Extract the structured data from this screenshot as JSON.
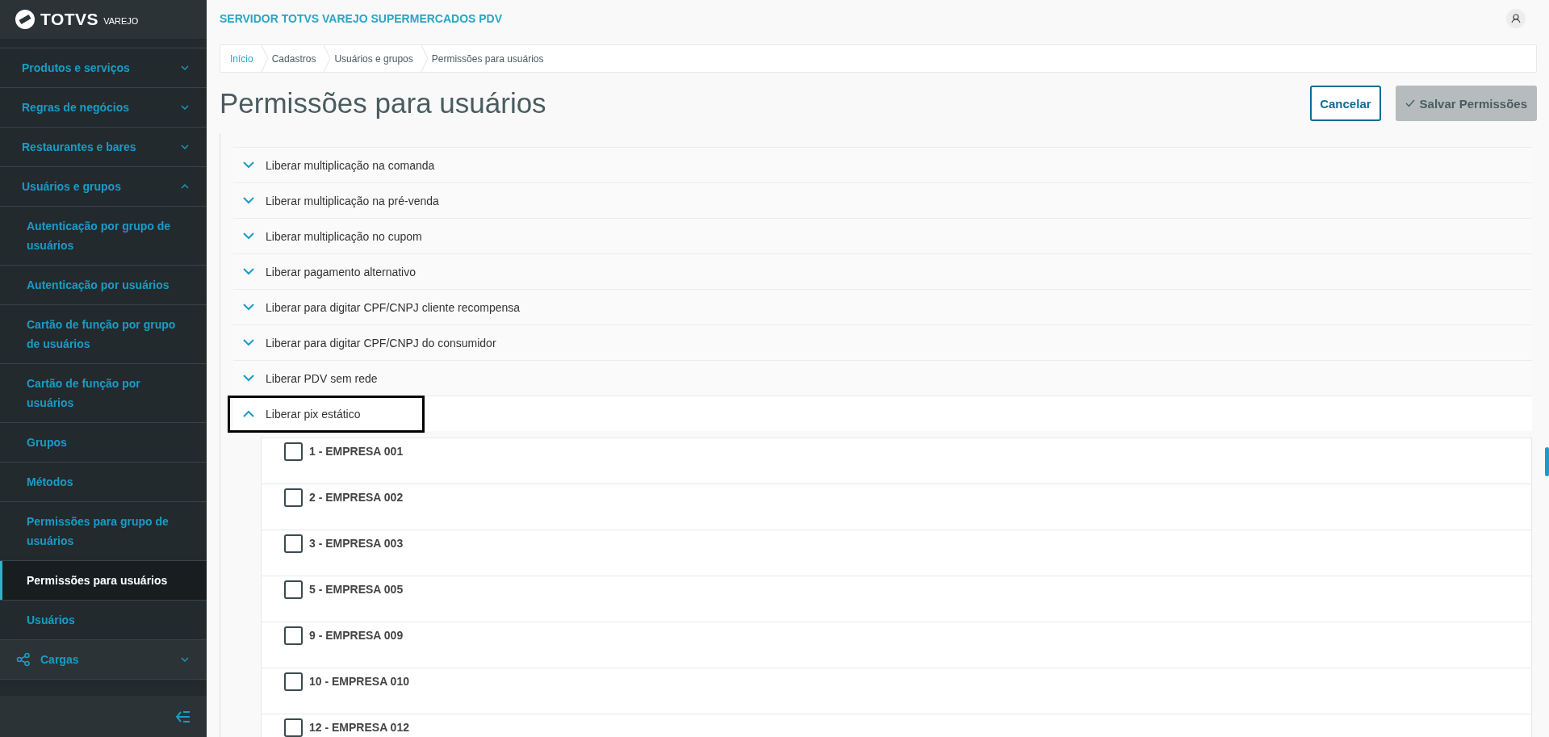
{
  "sidebar": {
    "logo": "TOTVS",
    "logo_sub": "VAREJO",
    "items": [
      {
        "label": "Produtos e serviços",
        "kind": "group",
        "expanded": false
      },
      {
        "label": "Regras de negócios",
        "kind": "group",
        "expanded": false
      },
      {
        "label": "Restaurantes e bares",
        "kind": "group",
        "expanded": false
      },
      {
        "label": "Usuários e grupos",
        "kind": "group",
        "expanded": true,
        "children": [
          {
            "label": "Autenticação por grupo de usuários",
            "selected": false
          },
          {
            "label": "Autenticação por usuários",
            "selected": false
          },
          {
            "label": "Cartão de função por grupo de usuários",
            "selected": false
          },
          {
            "label": "Cartão de função por usuários",
            "selected": false
          },
          {
            "label": "Grupos",
            "selected": false
          },
          {
            "label": "Métodos",
            "selected": false
          },
          {
            "label": "Permissões para grupo de usuários",
            "selected": false
          },
          {
            "label": "Permissões para usuários",
            "selected": true
          },
          {
            "label": "Usuários",
            "selected": false
          }
        ]
      },
      {
        "label": "Cargas",
        "kind": "module",
        "expanded": false
      }
    ]
  },
  "header": {
    "title": "SERVIDOR TOTVS VAREJO SUPERMERCADOS PDV"
  },
  "breadcrumb": [
    {
      "label": "Início",
      "link": true
    },
    {
      "label": "Cadastros",
      "link": false
    },
    {
      "label": "Usuários e grupos",
      "link": false
    },
    {
      "label": "Permissões para usuários",
      "link": false
    }
  ],
  "page_title": "Permissões para usuários",
  "buttons": [
    {
      "label": "Cancelar",
      "kind": "secondary",
      "disabled": false
    },
    {
      "label": "Salvar Permissões",
      "kind": "primary",
      "disabled": true
    }
  ],
  "permissions": [
    {
      "label": "Liberar multiplicação na comanda",
      "expanded": false,
      "focused": false
    },
    {
      "label": "Liberar multiplicação na pré-venda",
      "expanded": false,
      "focused": false
    },
    {
      "label": "Liberar multiplicação no cupom",
      "expanded": false,
      "focused": false
    },
    {
      "label": "Liberar pagamento alternativo",
      "expanded": false,
      "focused": false
    },
    {
      "label": "Liberar para digitar CPF/CNPJ cliente recompensa",
      "expanded": false,
      "focused": false
    },
    {
      "label": "Liberar para digitar CPF/CNPJ do consumidor",
      "expanded": false,
      "focused": false
    },
    {
      "label": "Liberar PDV sem rede",
      "expanded": false,
      "focused": false
    },
    {
      "label": "Liberar pix estático",
      "expanded": true,
      "focused": true,
      "companies": [
        {
          "label": "1 - EMPRESA 001",
          "checked": false
        },
        {
          "label": "2 - EMPRESA 002",
          "checked": false
        },
        {
          "label": "3 - EMPRESA 003",
          "checked": false
        },
        {
          "label": "5 - EMPRESA 005",
          "checked": false
        },
        {
          "label": "9 - EMPRESA 009",
          "checked": false
        },
        {
          "label": "10 - EMPRESA 010",
          "checked": false
        },
        {
          "label": "12 - EMPRESA 012",
          "checked": false
        }
      ]
    }
  ]
}
